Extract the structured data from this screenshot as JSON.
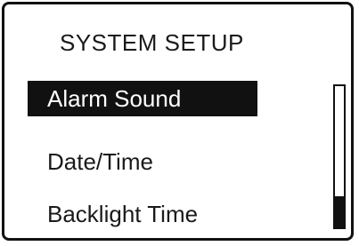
{
  "screen": {
    "title": "SYSTEM SETUP"
  },
  "menu": {
    "items": [
      {
        "label": "Alarm Sound",
        "selected": true
      },
      {
        "label": "Date/Time",
        "selected": false
      },
      {
        "label": "Backlight Time",
        "selected": false
      }
    ]
  },
  "scrollbar": {
    "position_fraction": 1.0,
    "thumb_fraction": 0.22
  },
  "colors": {
    "foreground": "#111111",
    "background": "#ffffff"
  }
}
